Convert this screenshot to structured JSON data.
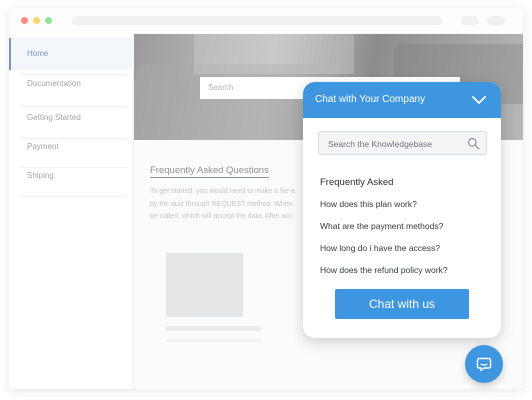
{
  "sidebar": {
    "items": [
      {
        "label": "Home"
      },
      {
        "label": "Documentation"
      },
      {
        "label": "Getting Started"
      },
      {
        "label": "Payment"
      },
      {
        "label": "Shiping"
      }
    ]
  },
  "hero": {
    "search_placeholder": "Search"
  },
  "content": {
    "title": "Frequently Asked Questions",
    "lines": [
      "To get started, you would need to make a file a",
      "by the quiz through REQUEST method. When",
      "be called, which will accept the data. After acc"
    ]
  },
  "chat": {
    "title": "Chat with Your Company",
    "search_placeholder": "Search the Knowledgebase",
    "faq_heading": "Frequently Asked",
    "questions": [
      "How does this plan work?",
      "What are the payment methods?",
      "How long do i have the access?",
      "How does the refund policy work?"
    ],
    "button_label": "Chat with us"
  },
  "colors": {
    "accent": "#3f96e0",
    "sidebar_active": "#7a93bf"
  },
  "icons": {
    "chat_collapse": "chevron-down-icon",
    "kb_search": "search-icon",
    "launcher": "chat-bubble-icon"
  }
}
